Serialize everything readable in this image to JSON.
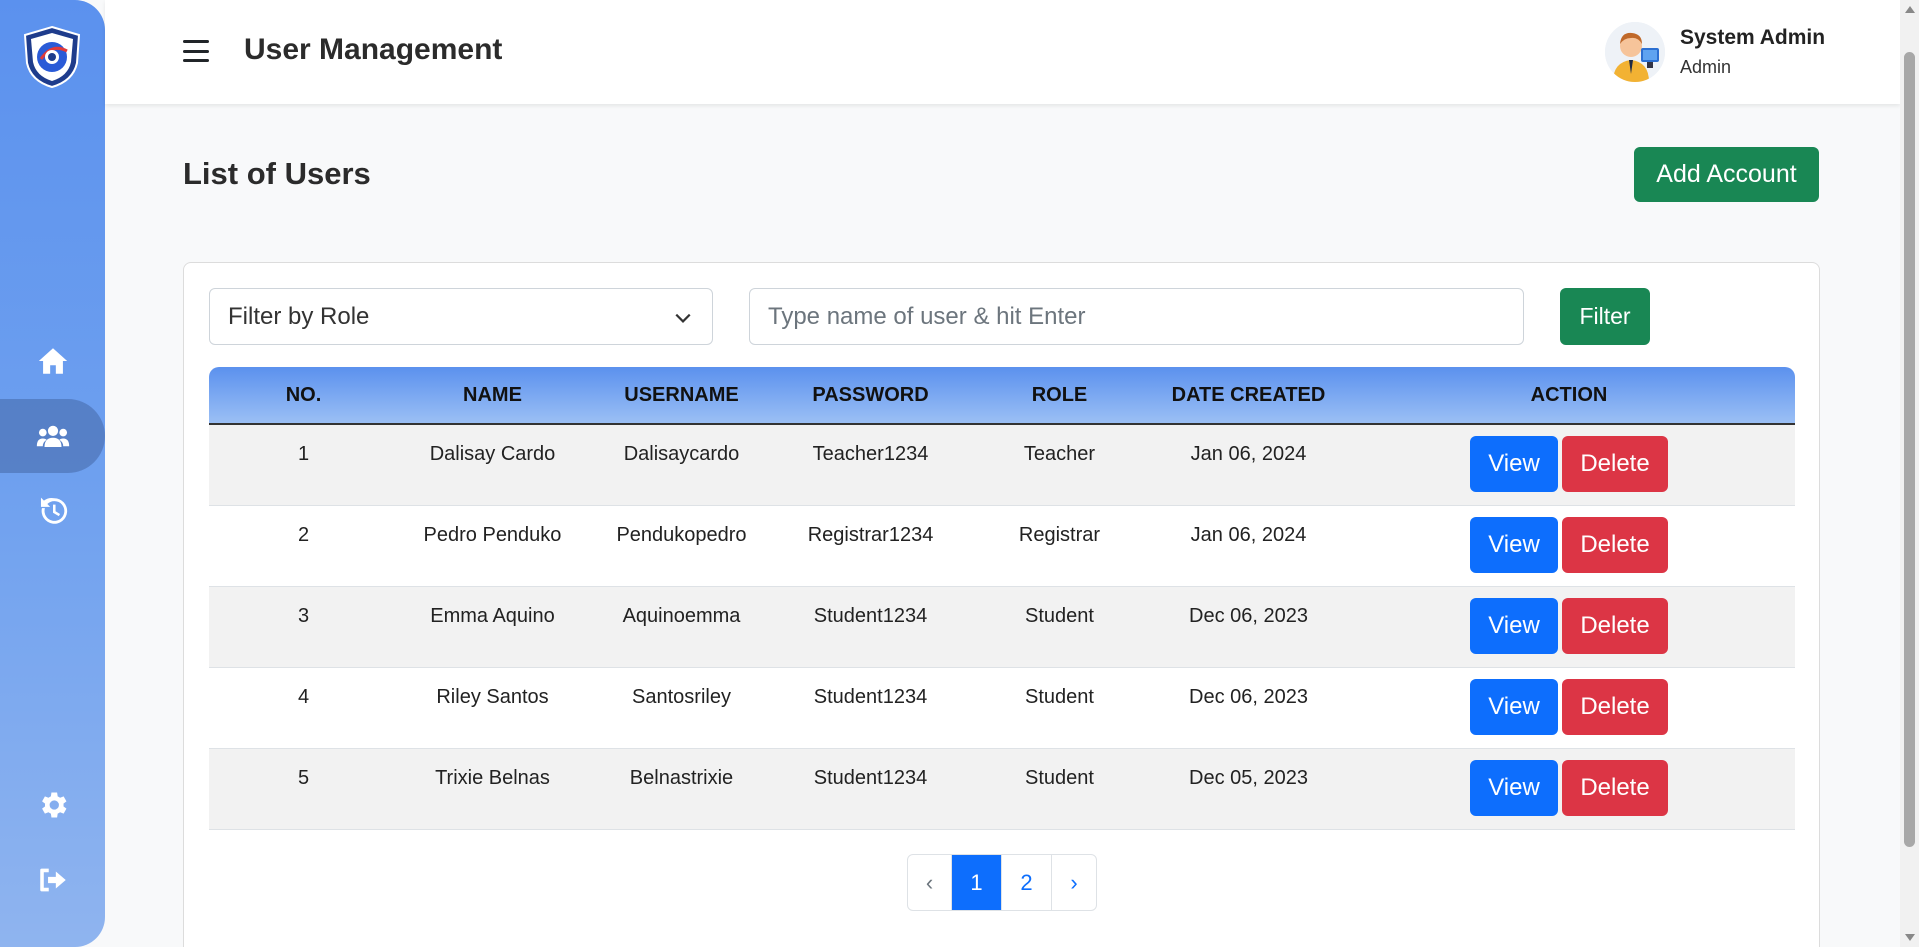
{
  "header": {
    "title": "User Management",
    "user_name": "System Admin",
    "user_role": "Admin"
  },
  "sidebar": {
    "items": [
      {
        "icon": "home-icon"
      },
      {
        "icon": "users-icon",
        "active": true
      },
      {
        "icon": "history-icon"
      },
      {
        "icon": "gear-icon"
      },
      {
        "icon": "logout-icon"
      }
    ]
  },
  "main": {
    "title": "List of Users",
    "add_button": "Add Account",
    "filter_role_label": "Filter by Role",
    "search_placeholder": "Type name of user & hit Enter",
    "filter_button": "Filter"
  },
  "table": {
    "columns": [
      "NO.",
      "NAME",
      "USERNAME",
      "PASSWORD",
      "ROLE",
      "DATE CREATED",
      "ACTION"
    ],
    "rows": [
      {
        "no": "1",
        "name": "Dalisay Cardo",
        "username": "Dalisaycardo",
        "password": "Teacher1234",
        "role": "Teacher",
        "date": "Jan 06, 2024"
      },
      {
        "no": "2",
        "name": "Pedro Penduko",
        "username": "Pendukopedro",
        "password": "Registrar1234",
        "role": "Registrar",
        "date": "Jan 06, 2024"
      },
      {
        "no": "3",
        "name": "Emma Aquino",
        "username": "Aquinoemma",
        "password": "Student1234",
        "role": "Student",
        "date": "Dec 06, 2023"
      },
      {
        "no": "4",
        "name": "Riley Santos",
        "username": "Santosriley",
        "password": "Student1234",
        "role": "Student",
        "date": "Dec 06, 2023"
      },
      {
        "no": "5",
        "name": "Trixie Belnas",
        "username": "Belnastrixie",
        "password": "Student1234",
        "role": "Student",
        "date": "Dec 05, 2023"
      }
    ],
    "view_label": "View",
    "delete_label": "Delete"
  },
  "pagination": {
    "prev": "‹",
    "pages": [
      "1",
      "2"
    ],
    "next": "›",
    "current": "1"
  },
  "colors": {
    "primary": "#0d6efd",
    "success": "#198754",
    "danger": "#dc3545",
    "sidebar": "#5b91ee"
  }
}
